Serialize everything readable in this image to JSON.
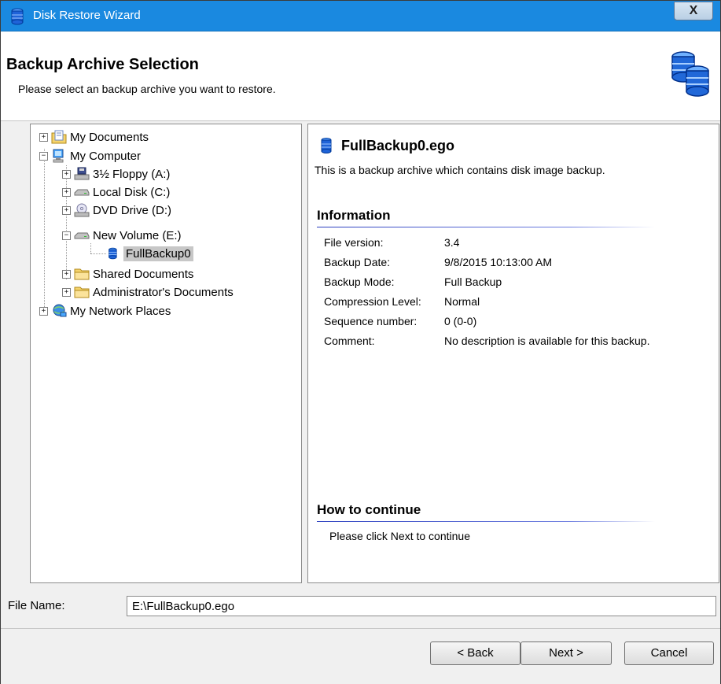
{
  "window": {
    "title": "Disk Restore Wizard",
    "close_label": "X"
  },
  "header": {
    "title": "Backup Archive Selection",
    "subtitle": "Please select an backup archive you want to restore."
  },
  "tree": {
    "items": [
      {
        "label": "My Documents",
        "icon": "my-documents-icon",
        "expander": "+"
      },
      {
        "label": "My Computer",
        "icon": "computer-icon",
        "expander": "−"
      },
      {
        "label": "3½ Floppy (A:)",
        "icon": "floppy-drive-icon",
        "expander": "+"
      },
      {
        "label": "Local Disk (C:)",
        "icon": "hard-disk-icon",
        "expander": "+"
      },
      {
        "label": "DVD Drive (D:)",
        "icon": "dvd-drive-icon",
        "expander": "+"
      },
      {
        "label": "New Volume (E:)",
        "icon": "hard-disk-icon",
        "expander": "−"
      },
      {
        "label": "FullBackup0",
        "icon": "backup-archive-icon",
        "selected": true
      },
      {
        "label": "Shared Documents",
        "icon": "folder-icon",
        "expander": "+"
      },
      {
        "label": "Administrator's Documents",
        "icon": "folder-icon",
        "expander": "+"
      },
      {
        "label": "My Network Places",
        "icon": "network-icon",
        "expander": "+"
      }
    ]
  },
  "info": {
    "file_title": "FullBackup0.ego",
    "description": "This is a backup archive which contains disk image backup.",
    "information_heading": "Information",
    "fields": [
      {
        "label": "File version:",
        "value": "3.4"
      },
      {
        "label": "Backup Date:",
        "value": "9/8/2015 10:13:00 AM"
      },
      {
        "label": "Backup Mode:",
        "value": "Full Backup"
      },
      {
        "label": "Compression Level:",
        "value": "Normal"
      },
      {
        "label": "Sequence number:",
        "value": "0 (0-0)"
      },
      {
        "label": "Comment:",
        "value": "No description is available for this backup."
      }
    ],
    "continue_heading": "How to continue",
    "continue_text": "Please click Next to continue"
  },
  "file_name": {
    "label": "File Name:",
    "value": "E:\\FullBackup0.ego"
  },
  "buttons": {
    "back": "< Back",
    "next": "Next >",
    "cancel": "Cancel"
  },
  "colors": {
    "titlebar": "#1a89e0",
    "accent_blue": "#2b3fbf",
    "selection": "#c7c7c7"
  }
}
